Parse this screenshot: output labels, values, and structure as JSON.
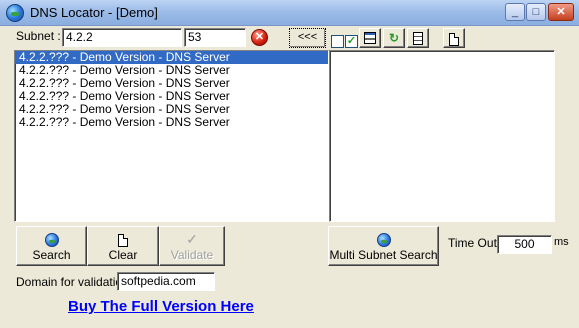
{
  "window": {
    "title": "DNS Locator - [Demo]",
    "min_glyph": "_",
    "max_glyph": "□",
    "close_glyph": "✕"
  },
  "subnet": {
    "label": "Subnet :",
    "value": "4.2.2",
    "range_value": "53",
    "stop_glyph": "✕",
    "toggle_label": "<<<"
  },
  "toolbar": {
    "check1": "",
    "check2": "✓",
    "refresh_glyph": "↻"
  },
  "results": [
    "4.2.2.??? - Demo Version - DNS Server",
    "4.2.2.??? - Demo Version - DNS Server",
    "4.2.2.??? - Demo Version - DNS Server",
    "4.2.2.??? - Demo Version - DNS Server",
    "4.2.2.??? - Demo Version - DNS Server",
    "4.2.2.??? - Demo Version - DNS Server"
  ],
  "buttons": {
    "search": "Search",
    "clear": "Clear",
    "validate": "Validate",
    "validate_glyph": "✓",
    "multi_subnet": "Multi Subnet Search"
  },
  "timeout": {
    "label": "Time Out:",
    "value": "500",
    "unit": "ms"
  },
  "validation": {
    "label": "Domain for validation :",
    "value": "softpedia.com"
  },
  "buy_link": "Buy The Full Version Here",
  "colors": {
    "selection": "#316ac5",
    "link": "#0000ff",
    "face": "#ece9d8"
  }
}
